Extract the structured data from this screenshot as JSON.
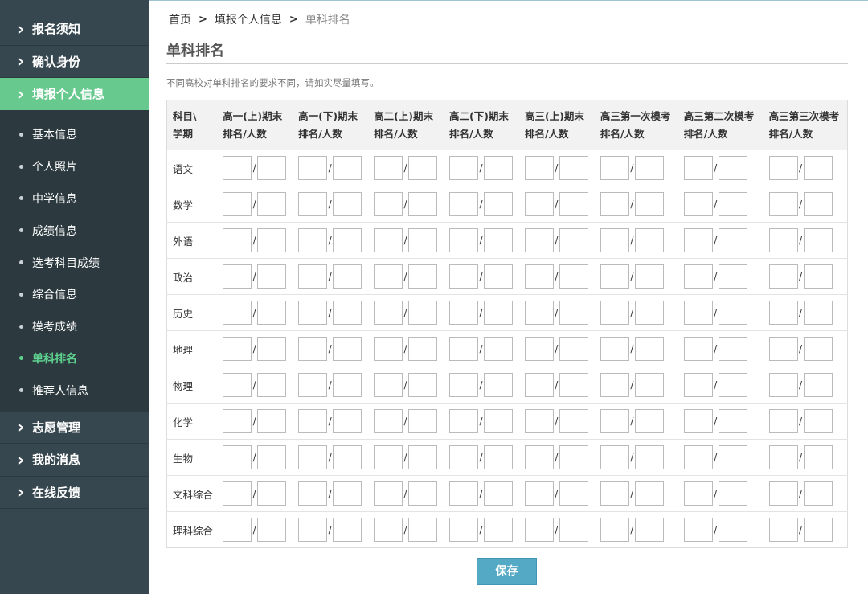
{
  "sidebar": {
    "top_items": [
      {
        "label": "报名须知"
      },
      {
        "label": "确认身份"
      },
      {
        "label": "填报个人信息"
      }
    ],
    "sub_items": [
      {
        "label": "基本信息"
      },
      {
        "label": "个人照片"
      },
      {
        "label": "中学信息"
      },
      {
        "label": "成绩信息"
      },
      {
        "label": "选考科目成绩"
      },
      {
        "label": "综合信息"
      },
      {
        "label": "模考成绩"
      },
      {
        "label": "单科排名"
      },
      {
        "label": "推荐人信息"
      }
    ],
    "bottom_items": [
      {
        "label": "志愿管理"
      },
      {
        "label": "我的消息"
      },
      {
        "label": "在线反馈"
      }
    ],
    "active_top": "填报个人信息",
    "active_sub": "单科排名",
    "chevron_icon": "chevron-right-icon"
  },
  "breadcrumb": {
    "home": "首页",
    "section": "填报个人信息",
    "current": "单科排名",
    "separator": ">"
  },
  "page": {
    "title": "单科排名",
    "hint": "不同高校对单科排名的要求不同，请如实尽量填写。"
  },
  "table": {
    "corner_line1": "科目\\",
    "corner_line2": "学期",
    "columns": [
      {
        "line1": "高一(上)期末",
        "line2": "排名/人数"
      },
      {
        "line1": "高一(下)期末",
        "line2": "排名/人数"
      },
      {
        "line1": "高二(上)期末",
        "line2": "排名/人数"
      },
      {
        "line1": "高二(下)期末",
        "line2": "排名/人数"
      },
      {
        "line1": "高三(上)期末",
        "line2": "排名/人数"
      },
      {
        "line1": "高三第一次模考",
        "line2": "排名/人数"
      },
      {
        "line1": "高三第二次模考",
        "line2": "排名/人数"
      },
      {
        "line1": "高三第三次模考",
        "line2": "排名/人数"
      }
    ],
    "subjects": [
      "语文",
      "数学",
      "外语",
      "政治",
      "历史",
      "地理",
      "物理",
      "化学",
      "生物",
      "文科综合",
      "理科综合"
    ],
    "slash": "/"
  },
  "actions": {
    "save_label": "保存"
  },
  "colors": {
    "sidebar_bg": "#37474f",
    "active_green": "#68c98f",
    "save_button": "#54a9c4"
  }
}
